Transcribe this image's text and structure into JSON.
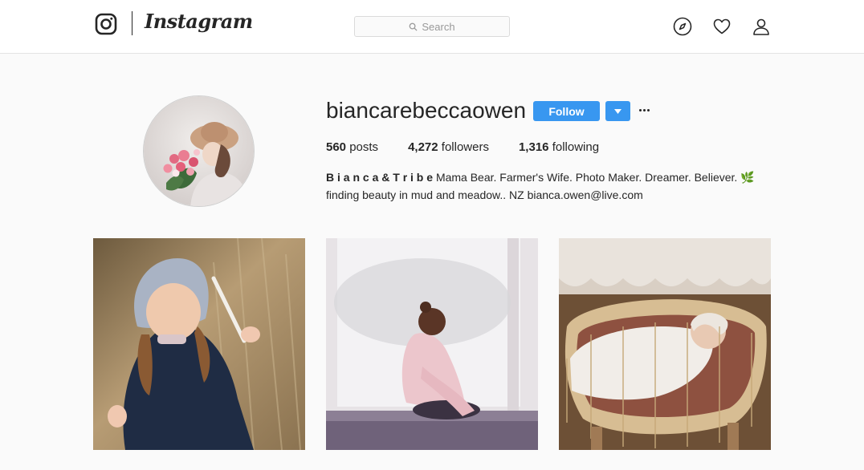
{
  "header": {
    "brand": "Instagram",
    "search_placeholder": "Search",
    "icons": [
      "instagram-glyph-icon",
      "explore-compass-icon",
      "activity-heart-icon",
      "profile-person-icon"
    ]
  },
  "profile": {
    "username": "biancarebeccaowen",
    "follow_label": "Follow",
    "stats": {
      "posts_count": "560",
      "posts_label": "posts",
      "followers_count": "4,272",
      "followers_label": "followers",
      "following_count": "1,316",
      "following_label": "following"
    },
    "bio": {
      "name": "B i a n c a & T r i b e",
      "line1": "Mama Bear. Farmer's Wife. Photo Maker. Dreamer. Believer. 🌿",
      "line2": "finding beauty in mud and meadow.. NZ bianca.owen@live.com"
    }
  },
  "posts": [
    {
      "subject": "girl in bonnet holding feather"
    },
    {
      "subject": "child sitting by window"
    },
    {
      "subject": "baby in moses basket"
    }
  ],
  "colors": {
    "accent": "#3897f0",
    "text": "#262626",
    "background": "#fafafa"
  }
}
